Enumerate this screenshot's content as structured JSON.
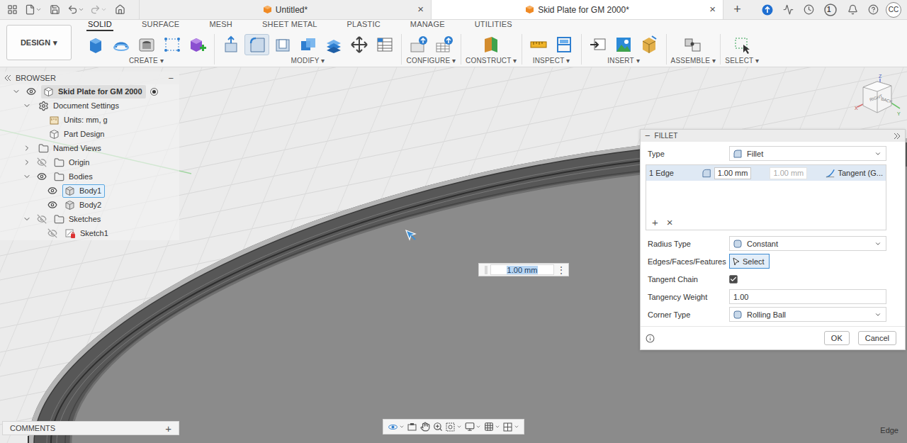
{
  "title_bar": {
    "tabs": [
      {
        "label": "Untitled*",
        "selected": false,
        "close": "×"
      },
      {
        "label": "Skid Plate for GM 2000*",
        "selected": true,
        "close": "×"
      }
    ],
    "new_tab": "+",
    "job_count": "1",
    "initials": "CC"
  },
  "workspace": {
    "label": "DESIGN",
    "caret": "▾"
  },
  "toolbar_tabs": [
    {
      "label": "SOLID",
      "selected": true
    },
    {
      "label": "SURFACE",
      "selected": false
    },
    {
      "label": "MESH",
      "selected": false
    },
    {
      "label": "SHEET METAL",
      "selected": false
    },
    {
      "label": "PLASTIC",
      "selected": false
    },
    {
      "label": "MANAGE",
      "selected": false
    },
    {
      "label": "UTILITIES",
      "selected": false
    }
  ],
  "tool_groups": [
    {
      "label": "CREATE",
      "caret": "▾",
      "tools": [
        {
          "selected": false
        },
        {
          "selected": false
        },
        {
          "selected": false
        },
        {
          "selected": false
        },
        {
          "selected": false
        }
      ]
    },
    {
      "label": "MODIFY",
      "caret": "▾",
      "tools": [
        {
          "selected": false
        },
        {
          "selected": true
        },
        {
          "selected": false
        },
        {
          "selected": false
        },
        {
          "selected": false
        },
        {
          "selected": false
        },
        {
          "selected": false
        }
      ]
    },
    {
      "label": "CONFIGURE",
      "caret": "▾",
      "tools": [
        {
          "selected": false
        },
        {
          "selected": false
        }
      ]
    },
    {
      "label": "CONSTRUCT",
      "caret": "▾",
      "tools": [
        {
          "selected": false
        }
      ]
    },
    {
      "label": "INSPECT",
      "caret": "▾",
      "tools": [
        {
          "selected": false
        },
        {
          "selected": false
        }
      ]
    },
    {
      "label": "INSERT",
      "caret": "▾",
      "tools": [
        {
          "selected": false
        },
        {
          "selected": false
        },
        {
          "selected": false
        }
      ]
    },
    {
      "label": "ASSEMBLE",
      "caret": "▾",
      "tools": [
        {
          "selected": false
        }
      ]
    },
    {
      "label": "SELECT",
      "caret": "▾",
      "tools": [
        {
          "selected": false
        }
      ]
    }
  ],
  "browser": {
    "title": "BROWSER",
    "collapse": "−",
    "items": [
      {
        "label": "Skid Plate for GM 2000",
        "level": 0,
        "kind": "component",
        "expanded": true,
        "visible": true,
        "active": true
      },
      {
        "label": "Document Settings",
        "level": 1,
        "kind": "settings",
        "expanded": true
      },
      {
        "label": "Units: mm, g",
        "level": 2,
        "kind": "units"
      },
      {
        "label": "Part Design",
        "level": 2,
        "kind": "design"
      },
      {
        "label": "Named Views",
        "level": 1,
        "kind": "folder",
        "expanded": false
      },
      {
        "label": "Origin",
        "level": 1,
        "kind": "folder",
        "expanded": false,
        "visible": false
      },
      {
        "label": "Bodies",
        "level": 1,
        "kind": "folder",
        "expanded": true,
        "visible": true
      },
      {
        "label": "Body1",
        "level": 2,
        "kind": "body",
        "visible": true,
        "selected": true
      },
      {
        "label": "Body2",
        "level": 2,
        "kind": "body",
        "visible": true,
        "selected": false
      },
      {
        "label": "Sketches",
        "level": 1,
        "kind": "folder",
        "expanded": true,
        "visible": false
      },
      {
        "label": "Sketch1",
        "level": 2,
        "kind": "sketch",
        "visible": false
      }
    ]
  },
  "fillet": {
    "title": "FILLET",
    "collapse": "−",
    "type": {
      "label": "Type",
      "value": "Fillet"
    },
    "selection_row": {
      "count": "1 Edge",
      "radius": "1.00 mm",
      "radius2": "1.00 mm",
      "radius2_disabled": true,
      "continuity": "Tangent (G...",
      "selected": true
    },
    "add": "+",
    "remove": "×",
    "fields": [
      {
        "kind": "dropdown",
        "label": "Radius Type",
        "value": "Constant"
      },
      {
        "kind": "select",
        "label": "Edges/Faces/Features",
        "value": "Select",
        "selected": true
      },
      {
        "kind": "checkbox",
        "label": "Tangent Chain",
        "checked": true
      },
      {
        "kind": "input",
        "label": "Tangency Weight",
        "value": "1.00"
      },
      {
        "kind": "dropdown",
        "label": "Corner Type",
        "value": "Rolling Ball"
      }
    ],
    "buttons": [
      {
        "label": "OK"
      },
      {
        "label": "Cancel"
      }
    ]
  },
  "dimension_input": {
    "value": "1.00 mm",
    "menu": "⋮"
  },
  "viewcube": {
    "faces": [
      "RIGHT",
      "BACK"
    ],
    "axes": [
      "Z",
      "X",
      "Y"
    ]
  },
  "comments": {
    "title": "COMMENTS",
    "add": "+"
  },
  "status": "Edge"
}
